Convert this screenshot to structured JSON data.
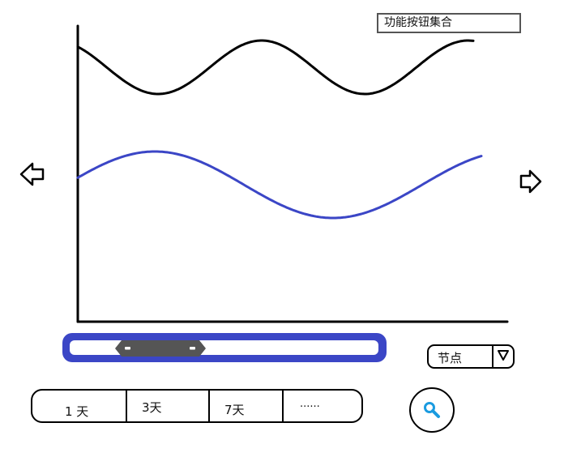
{
  "toolbar": {
    "function_button_label": "功能按钮集合"
  },
  "chart_data": {
    "type": "line",
    "title": "",
    "xlabel": "",
    "ylabel": "",
    "series": [
      {
        "color": "#000000"
      },
      {
        "color": "#3b46c6"
      }
    ]
  },
  "navigation": {
    "prev_icon": "arrow-left-icon",
    "next_icon": "arrow-right-icon"
  },
  "range_slider": {
    "track_color": "#3b46c6",
    "thumb_color": "#555555"
  },
  "node_select": {
    "selected_label": "节点",
    "caret_icon": "triangle-down-icon"
  },
  "time_range": {
    "options": [
      "1 天",
      "3天",
      "7天",
      "......"
    ]
  },
  "search": {
    "icon": "search-icon",
    "icon_color": "#1a9be0"
  }
}
